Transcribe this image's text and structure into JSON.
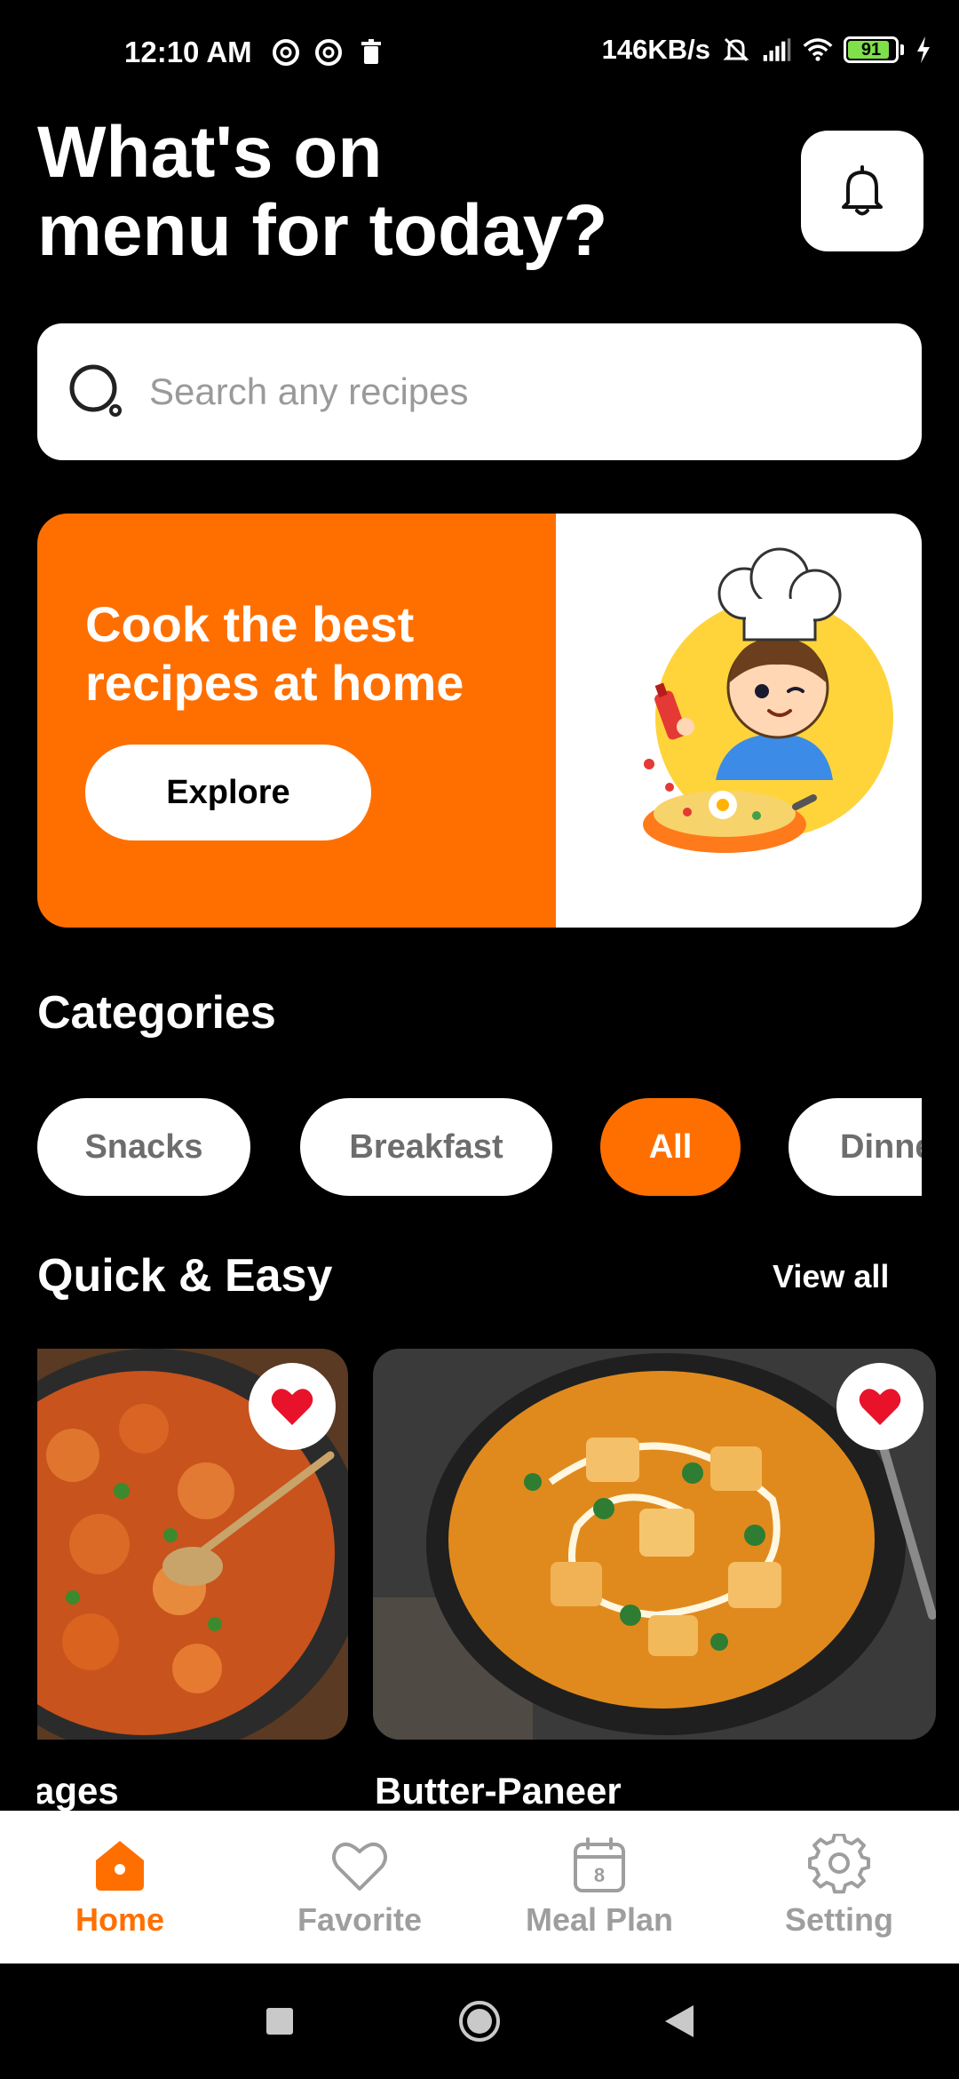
{
  "status_bar": {
    "time": "12:10 AM",
    "net_speed": "146KB/s",
    "battery": "91",
    "icons": [
      "circle-at-icon",
      "circle-at-icon",
      "trash-icon",
      "mute-icon",
      "signal-icon",
      "wifi-icon",
      "battery-icon",
      "charging-icon"
    ]
  },
  "header": {
    "line1": "What's on",
    "line2": "menu for today?",
    "bell_icon": "bell-icon"
  },
  "search": {
    "placeholder": "Search any recipes",
    "icon": "search-icon"
  },
  "banner": {
    "line1": "Cook the best",
    "line2": "recipes at home",
    "button": "Explore",
    "accent": "#ff6f00",
    "image": "chef-cartoon"
  },
  "categories": {
    "title": "Categories",
    "items": [
      {
        "label": "Snacks",
        "active": false
      },
      {
        "label": "Breakfast",
        "active": false
      },
      {
        "label": "All",
        "active": true
      },
      {
        "label": "Dinne",
        "active": false
      }
    ]
  },
  "quick_easy": {
    "title": "Quick & Easy",
    "view_all": "View all",
    "recipes": [
      {
        "title": "ages",
        "favorite": true
      },
      {
        "title": "Butter-Paneer",
        "favorite": true
      }
    ]
  },
  "bottom_nav": {
    "items": [
      {
        "label": "Home",
        "icon": "home-icon",
        "active": true
      },
      {
        "label": "Favorite",
        "icon": "heart-icon",
        "active": false
      },
      {
        "label": "Meal Plan",
        "icon": "calendar-icon",
        "badge": "8",
        "active": false
      },
      {
        "label": "Setting",
        "icon": "gear-icon",
        "active": false
      }
    ]
  },
  "colors": {
    "accent": "#ff6f00",
    "background": "#000000",
    "heart": "#e8132b"
  }
}
